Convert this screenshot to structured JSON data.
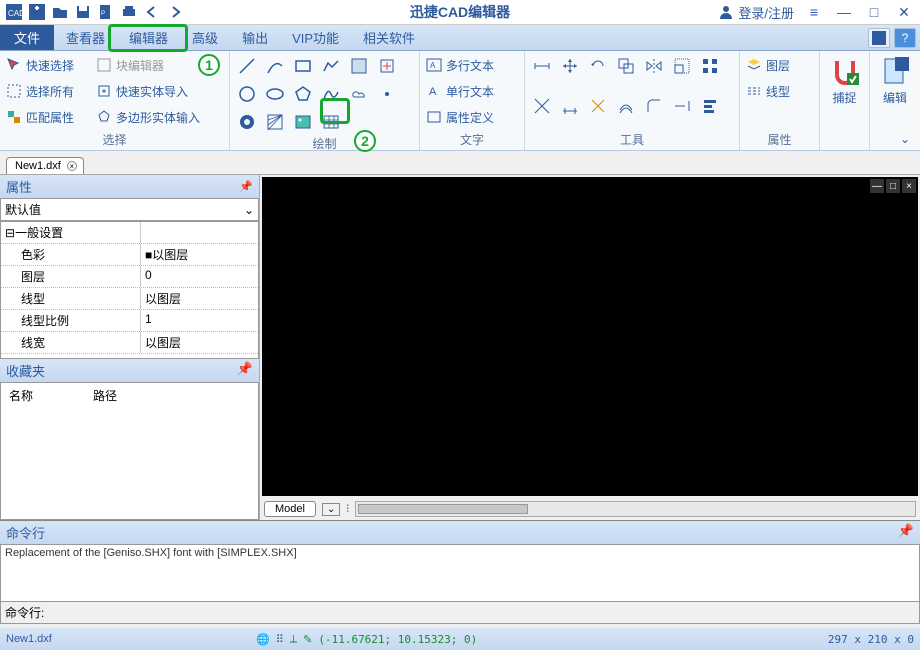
{
  "app_title": "迅捷CAD编辑器",
  "login": "登录/注册",
  "menu": {
    "file": "文件",
    "tabs": [
      "查看器",
      "编辑器",
      "高级",
      "输出",
      "VIP功能",
      "相关软件"
    ]
  },
  "ribbon": {
    "select": {
      "label": "选择",
      "items": [
        "快速选择",
        "选择所有",
        "匹配属性"
      ],
      "block_editor": "块编辑器",
      "items2": [
        "快速实体导入",
        "多边形实体输入"
      ]
    },
    "draw": {
      "label": "绘制"
    },
    "text": {
      "label": "文字",
      "items": [
        "多行文本",
        "单行文本",
        "属性定义"
      ]
    },
    "tools": {
      "label": "工具"
    },
    "props": {
      "label": "属性",
      "items": [
        "图层",
        "线型"
      ]
    },
    "snap": {
      "label": "捕捉"
    },
    "edit": {
      "label": "编辑"
    }
  },
  "doc_tab": "New1.dxf",
  "props_panel": {
    "title": "属性",
    "default": "默认值",
    "group": "一般设置",
    "rows": [
      {
        "k": "色彩",
        "v": "■以图层"
      },
      {
        "k": "图层",
        "v": "0"
      },
      {
        "k": "线型",
        "v": "以图层"
      },
      {
        "k": "线型比例",
        "v": "1"
      },
      {
        "k": "线宽",
        "v": "以图层"
      }
    ]
  },
  "fav": {
    "title": "收藏夹",
    "cols": [
      "名称",
      "路径"
    ]
  },
  "model_tab": "Model",
  "cmd": {
    "title": "命令行",
    "log": "Replacement of the [Geniso.SHX] font with [SIMPLEX.SHX]",
    "label": "命令行:"
  },
  "status": {
    "file": "New1.dxf",
    "coords": "(-11.67621; 10.15323; 0)",
    "dims": "297 x 210 x 0"
  },
  "annot": {
    "n1": "1",
    "n2": "2"
  }
}
